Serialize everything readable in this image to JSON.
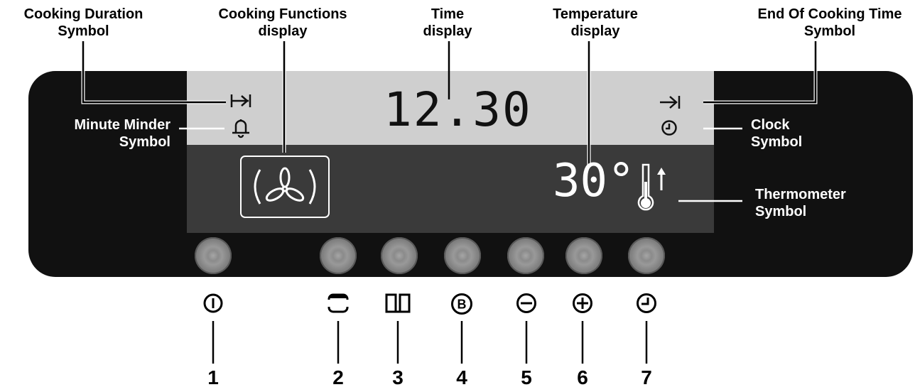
{
  "labels": {
    "cooking_duration": [
      "Cooking  Duration",
      "Symbol"
    ],
    "cooking_functions": [
      "Cooking Functions",
      "display"
    ],
    "time_display": [
      "Time",
      "display"
    ],
    "temperature_display": [
      "Temperature",
      "display"
    ],
    "end_of_cooking": [
      "End Of Cooking Time",
      "Symbol"
    ],
    "minute_minder": [
      "Minute Minder",
      "Symbol"
    ],
    "clock_symbol": [
      "Clock",
      "Symbol"
    ],
    "thermometer_symbol": [
      "Thermometer",
      "Symbol"
    ]
  },
  "display": {
    "time": "12.30",
    "temperature": "30°"
  },
  "buttons": [
    {
      "number": "1",
      "icon": "power-icon"
    },
    {
      "number": "2",
      "icon": "function-icon"
    },
    {
      "number": "3",
      "icon": "book-icon"
    },
    {
      "number": "4",
      "icon": "b-icon"
    },
    {
      "number": "5",
      "icon": "minus-icon"
    },
    {
      "number": "6",
      "icon": "plus-icon"
    },
    {
      "number": "7",
      "icon": "clock-icon"
    }
  ],
  "colors": {
    "panel": "#111111",
    "lcd_top": "#cfcfcf",
    "lcd_bottom": "#3a3a3a"
  }
}
